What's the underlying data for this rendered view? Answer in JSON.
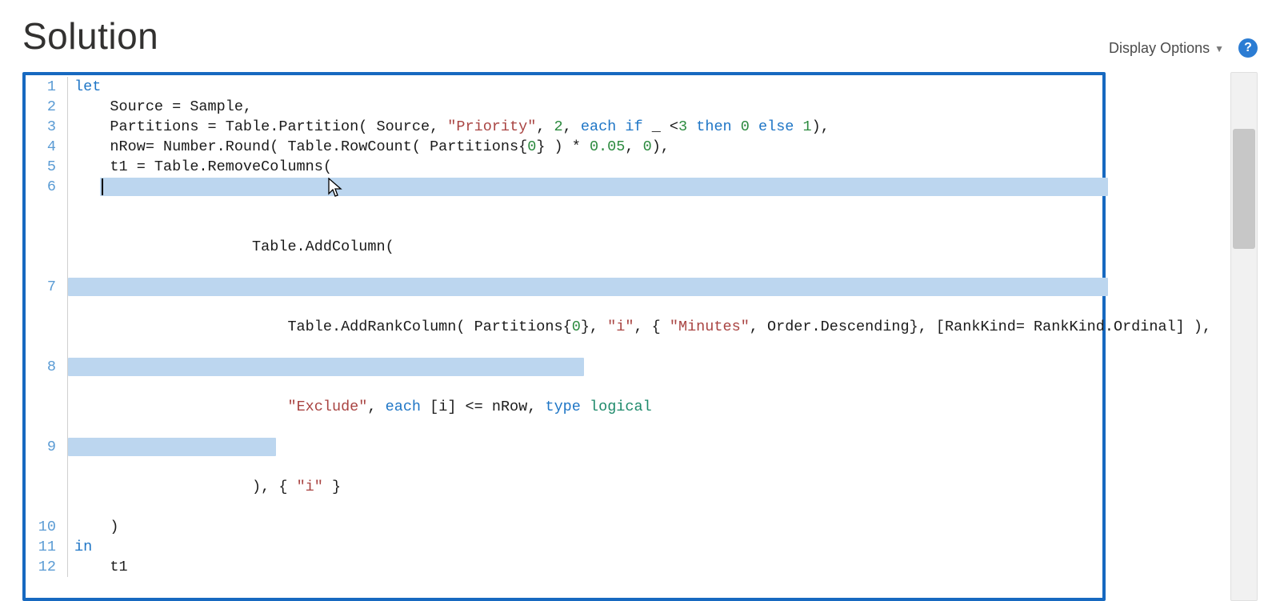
{
  "header": {
    "title": "Solution",
    "display_options_label": "Display Options",
    "help_label": "?"
  },
  "editor": {
    "lines": [
      "1",
      "2",
      "3",
      "4",
      "5",
      "6",
      "7",
      "8",
      "9",
      "10",
      "11",
      "12"
    ],
    "code": {
      "l1_kw": "let",
      "l2_a": "    Source = Sample,",
      "l3_a": "    Partitions = Table.Partition( Source, ",
      "l3_str": "\"Priority\"",
      "l3_b": ", ",
      "l3_num1": "2",
      "l3_c": ", ",
      "l3_kw_each": "each",
      "l3_d": " ",
      "l3_kw_if": "if",
      "l3_e": " _ <",
      "l3_num2": "3",
      "l3_f": " ",
      "l3_kw_then": "then",
      "l3_g": " ",
      "l3_num3": "0",
      "l3_h": " ",
      "l3_kw_else": "else",
      "l3_i": " ",
      "l3_num4": "1",
      "l3_j": "),",
      "l4_a": "    nRow= Number.Round( Table.RowCount( Partitions{",
      "l4_num1": "0",
      "l4_b": "} ) * ",
      "l4_num2": "0.05",
      "l4_c": ", ",
      "l4_num3": "0",
      "l4_d": "),",
      "l5_a": "    t1 = Table.RemoveColumns(",
      "l6_a": "        Table.AddColumn(",
      "l7_a": "            Table.AddRankColumn( Partitions{",
      "l7_num1": "0",
      "l7_b": "}, ",
      "l7_str_i": "\"i\"",
      "l7_c": ", { ",
      "l7_str_min": "\"Minutes\"",
      "l7_d": ", Order.Descending}, [RankKind= RankKind.Ordinal] ),",
      "l8_a": "            ",
      "l8_str_ex": "\"Exclude\"",
      "l8_b": ", ",
      "l8_kw_each": "each",
      "l8_c": " [i] <= nRow, ",
      "l8_kw_type": "type",
      "l8_d": " ",
      "l8_type_logical": "logical",
      "l9_a": "        ), { ",
      "l9_str_i": "\"i\"",
      "l9_b": " }",
      "l10_a": "    )",
      "l11_kw": "in",
      "l12_a": "    t1"
    }
  }
}
